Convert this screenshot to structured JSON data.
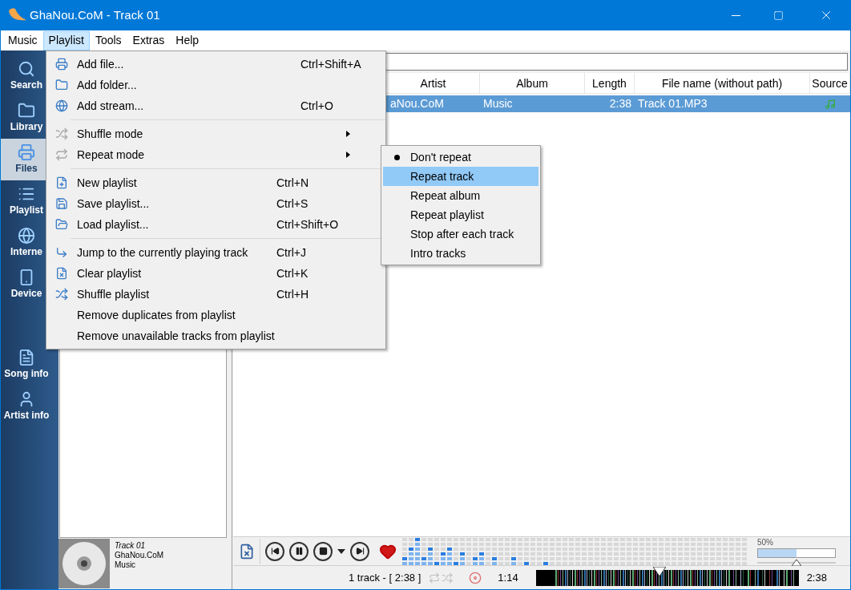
{
  "window": {
    "title": "GhaNou.CoM - Track 01"
  },
  "menu_bar": [
    {
      "label": "Music",
      "selected": false
    },
    {
      "label": "Playlist",
      "selected": true
    },
    {
      "label": "Tools",
      "selected": false
    },
    {
      "label": "Extras",
      "selected": false
    },
    {
      "label": "Help",
      "selected": false
    }
  ],
  "sidebar": {
    "items": [
      {
        "label": "Search",
        "selected": false
      },
      {
        "label": "Library",
        "selected": false
      },
      {
        "label": "Files",
        "selected": true
      },
      {
        "label": "Playlist",
        "selected": false
      },
      {
        "label": "Interne",
        "selected": false
      },
      {
        "label": "Device",
        "selected": false
      },
      {
        "label": "Song info",
        "selected": false
      },
      {
        "label": "Artist info",
        "selected": false
      }
    ]
  },
  "playlist_menu": {
    "sections": [
      [
        {
          "label": "Add file...",
          "shortcut": "Ctrl+Shift+A",
          "submenu": false
        },
        {
          "label": "Add folder...",
          "submenu": false
        },
        {
          "label": "Add stream...",
          "shortcut": "Ctrl+O",
          "submenu": false
        }
      ],
      [
        {
          "label": "Shuffle mode",
          "submenu": true
        },
        {
          "label": "Repeat mode",
          "submenu": true
        }
      ],
      [
        {
          "label": "New playlist",
          "shortcut": "Ctrl+N",
          "submenu": false
        },
        {
          "label": "Save playlist...",
          "shortcut": "Ctrl+S",
          "submenu": false
        },
        {
          "label": "Load playlist...",
          "shortcut": "Ctrl+Shift+O",
          "submenu": false
        }
      ],
      [
        {
          "label": "Jump to the currently playing track",
          "shortcut": "Ctrl+J",
          "submenu": false
        },
        {
          "label": "Clear playlist",
          "shortcut": "Ctrl+K",
          "submenu": false
        },
        {
          "label": "Shuffle playlist",
          "shortcut": "Ctrl+H",
          "submenu": false
        },
        {
          "label": "Remove duplicates from playlist",
          "submenu": false
        },
        {
          "label": "Remove unavailable tracks from playlist",
          "submenu": false
        }
      ]
    ]
  },
  "repeat_submenu": {
    "items": [
      {
        "label": "Don't repeat",
        "checked": true,
        "highlighted": false
      },
      {
        "label": "Repeat track",
        "checked": false,
        "highlighted": true
      },
      {
        "label": "Repeat album",
        "checked": false,
        "highlighted": false
      },
      {
        "label": "Repeat playlist",
        "checked": false,
        "highlighted": false
      },
      {
        "label": "Stop after each track",
        "checked": false,
        "highlighted": false
      },
      {
        "label": "Intro tracks",
        "checked": false,
        "highlighted": false
      }
    ]
  },
  "table": {
    "columns": [
      "Artist",
      "Album",
      "Length",
      "File name (without path)",
      "Source"
    ],
    "rows": [
      {
        "cells": [
          "aNou.CoM",
          "Music",
          "2:38",
          "Track 01.MP3"
        ],
        "selected": true
      }
    ]
  },
  "now_playing": {
    "title": "Track 01",
    "artist": "GhaNou.CoM",
    "album": "Music"
  },
  "volume": {
    "reading": "50%",
    "level": 0.5
  },
  "status_bar": {
    "summary": "1 track - [ 2:38 ]",
    "elapsed": "1:14",
    "total": "2:38",
    "seek": {
      "level": 0.47
    }
  }
}
